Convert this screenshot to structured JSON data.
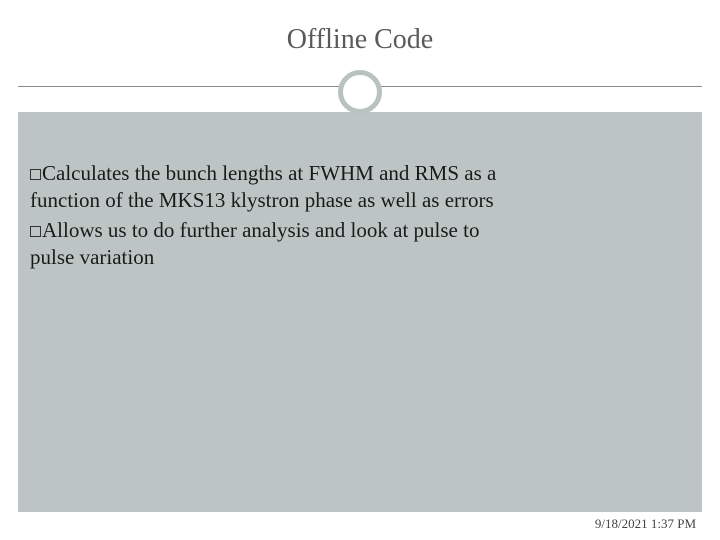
{
  "title": "Offline Code",
  "bullets": [
    {
      "lead": "Calculates the bunch lengths at FWHM and RMS as a",
      "cont": "function of the MKS13 klystron phase as well as errors"
    },
    {
      "lead": "Allows us to do further analysis and look at pulse to",
      "cont": "pulse variation"
    }
  ],
  "footer": "9/18/2021 1:37 PM"
}
